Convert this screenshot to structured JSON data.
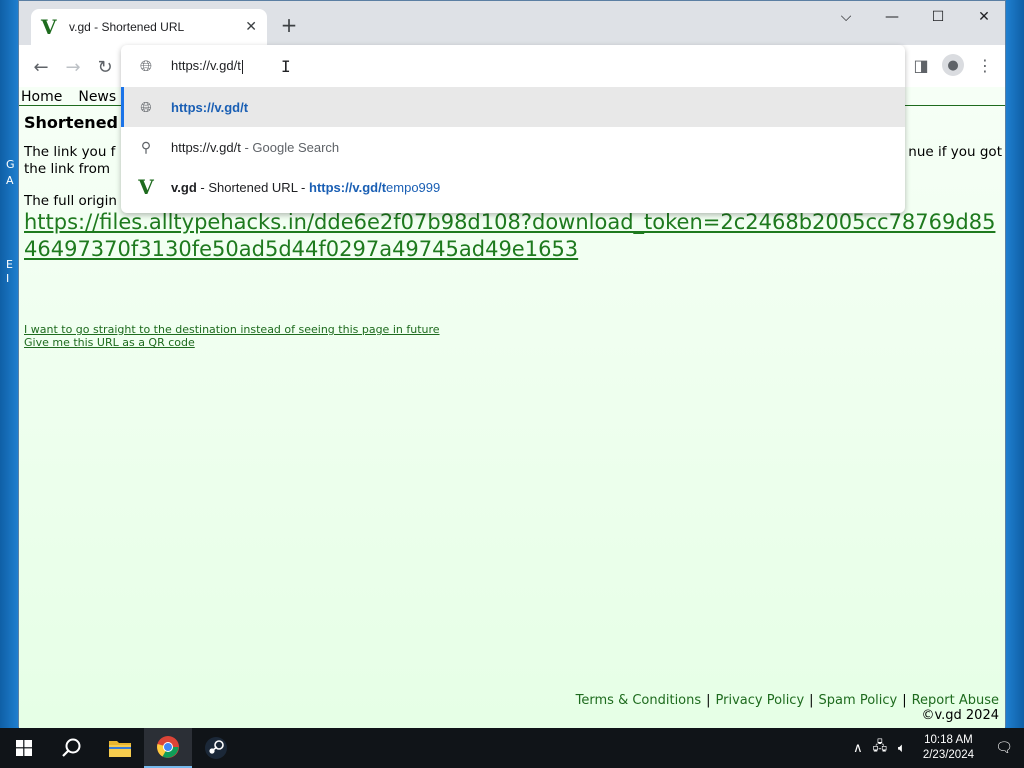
{
  "window": {
    "tab_title": "v.gd - Shortened URL",
    "tab_favicon": "V",
    "new_tab_symbol": "+",
    "controls": {
      "dropdown": "⌵",
      "minimize": "—",
      "maximize": "☐",
      "close": "✕"
    }
  },
  "toolbar": {
    "back_icon": "←",
    "forward_icon": "→",
    "reload_icon": "↻",
    "sidepanel_icon": "◨",
    "profile_icon": "👤",
    "menu_icon": "⋮"
  },
  "omnibox": {
    "typed_text": "https://v.gd/t",
    "suggestions": [
      {
        "icon": "globe",
        "bold_text": "https://v.gd/t"
      },
      {
        "icon": "search",
        "text": "https://v.gd/t",
        "suffix": " - Google Search"
      },
      {
        "icon": "vgd",
        "site": "v.gd",
        "middle": " - Shortened URL - ",
        "url_match": "https://v.gd/t",
        "url_rest": "empo999"
      }
    ]
  },
  "page": {
    "nav": [
      "Home",
      "News"
    ],
    "heading": "Shortened",
    "para1_left": "The link you f",
    "para1_right": "nue if you got",
    "para1_line2": "the link from",
    "para2": "The full origin",
    "long_url": "https://files.alltypehacks.in/dde6e2f07b98d108?download_token=2c2468b2005cc78769d8546497370f3130fe50ad5d44f0297a49745ad49e1653",
    "link_straight": "I want to go straight to the destination instead of seeing this page in future",
    "link_qr": "Give me this URL as a QR code",
    "footer": {
      "terms": "Terms & Conditions",
      "privacy": "Privacy Policy",
      "spam": "Spam Policy",
      "abuse": "Report Abuse",
      "separator": "|",
      "copyright": "©v.gd 2024"
    }
  },
  "desktop": {
    "left_fragments": [
      "G",
      "A",
      "E",
      "I"
    ]
  },
  "taskbar": {
    "start_icon": "windows-logo",
    "time": "10:18 AM",
    "date": "2/23/2024"
  }
}
